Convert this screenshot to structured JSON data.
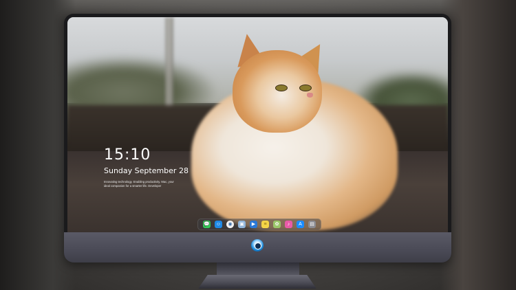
{
  "lock_screen": {
    "time": "15:10",
    "date": "Sunday September 28",
    "tagline": "Innovating technology. Enabling productivity. Mac, your ideal companion for a smarter life. Developer"
  },
  "dock": {
    "apps": [
      {
        "name": "messages",
        "color": "#34c759",
        "glyph": "💬"
      },
      {
        "name": "finder",
        "color": "#1e88e5",
        "glyph": "☺"
      },
      {
        "name": "safari",
        "color": "#f2f2f2",
        "glyph": "◉"
      },
      {
        "name": "preview",
        "color": "#8fb4d8",
        "glyph": "▣"
      },
      {
        "name": "claquette",
        "color": "#2a78d6",
        "glyph": "▶"
      },
      {
        "name": "notes",
        "color": "#f5d547",
        "glyph": "≡"
      },
      {
        "name": "photos",
        "color": "#9ac66a",
        "glyph": "✿"
      },
      {
        "name": "music",
        "color": "#e85aa8",
        "glyph": "♪"
      },
      {
        "name": "app-store",
        "color": "#1a8cff",
        "glyph": "A"
      },
      {
        "name": "utility",
        "color": "#8a8a90",
        "glyph": "▤"
      }
    ]
  },
  "colors": {
    "bezel": "#1a1a1c",
    "chin": "#4a4a56",
    "text": "#ffffff"
  }
}
